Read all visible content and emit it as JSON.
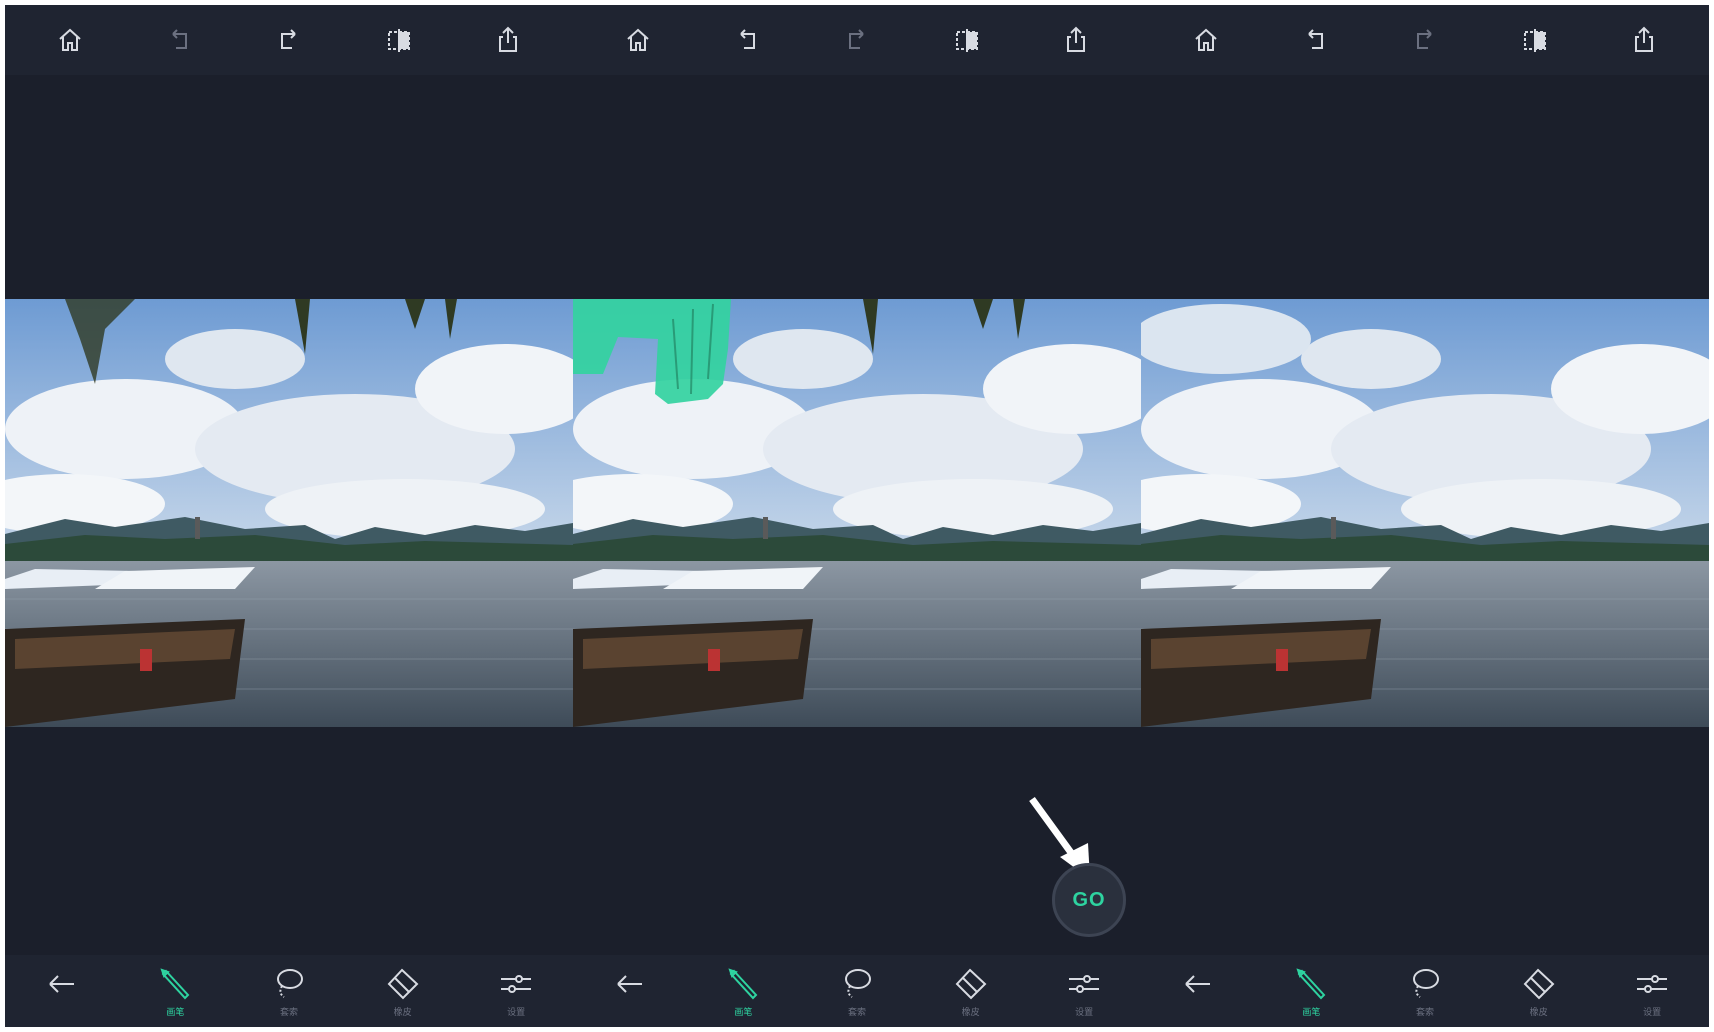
{
  "screens": [
    {
      "id": "before",
      "willow_masked": false,
      "willow_visible": true
    },
    {
      "id": "masked",
      "willow_masked": true,
      "willow_visible": true
    },
    {
      "id": "after",
      "willow_masked": false,
      "willow_visible": false
    }
  ],
  "topbar": {
    "buttons": [
      {
        "name": "home",
        "icon": "home-icon"
      },
      {
        "name": "undo",
        "icon": "undo-icon"
      },
      {
        "name": "redo",
        "icon": "redo-icon"
      },
      {
        "name": "compare",
        "icon": "compare-icon"
      },
      {
        "name": "share",
        "icon": "share-icon"
      }
    ]
  },
  "bottombar": {
    "buttons": [
      {
        "name": "back",
        "icon": "back-arrow-icon",
        "label": ""
      },
      {
        "name": "brush",
        "icon": "brush-icon",
        "label": "画笔",
        "active": true
      },
      {
        "name": "lasso",
        "icon": "lasso-icon",
        "label": "套索"
      },
      {
        "name": "eraser",
        "icon": "eraser-icon",
        "label": "橡皮"
      },
      {
        "name": "settings",
        "icon": "sliders-icon",
        "label": "设置"
      }
    ]
  },
  "go_button": {
    "label": "GO"
  },
  "colors": {
    "background": "#1b1f2b",
    "bar": "#1f2431",
    "accent": "#2ed3a0",
    "icon": "#d8dbe2",
    "icon_disabled": "#6b7080",
    "mask": "#33d3a0"
  }
}
